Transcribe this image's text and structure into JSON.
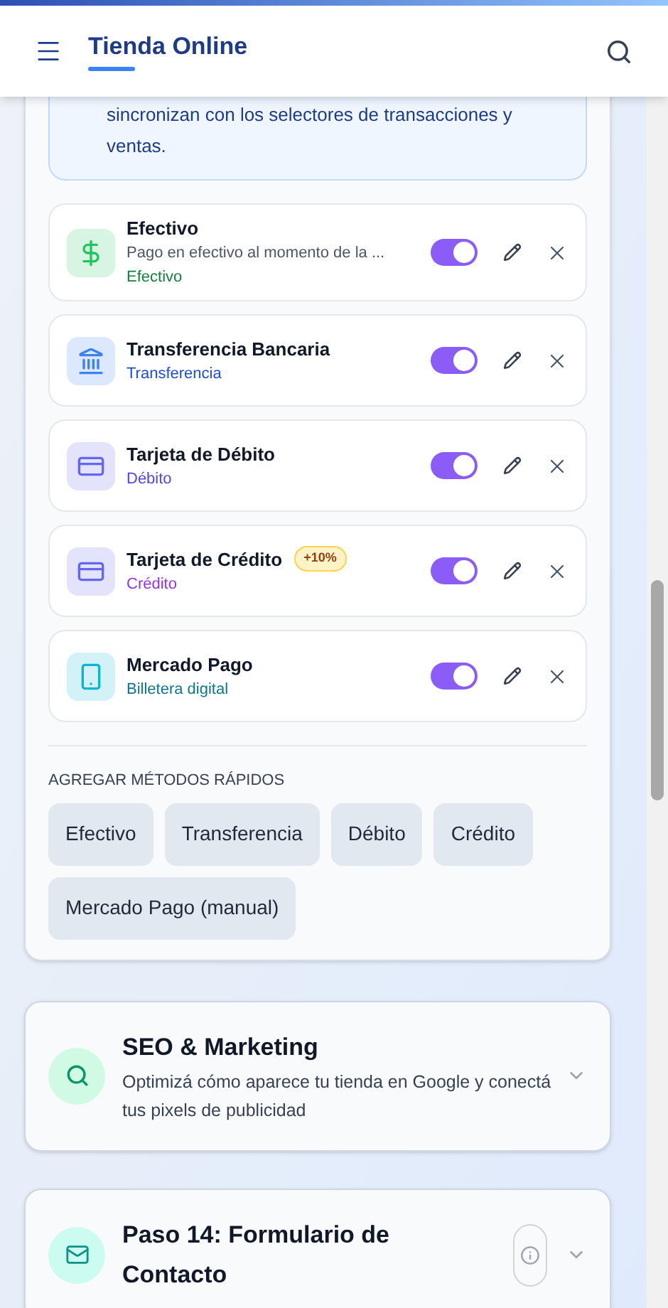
{
  "header": {
    "title": "Tienda Online"
  },
  "info_note": {
    "text": "sincronizan con los selectores de transacciones y ventas."
  },
  "methods": [
    {
      "kind": "cash",
      "name": "Efectivo",
      "description": "Pago en efectivo al momento de la ...",
      "type": "Efectivo",
      "color": "#15803d",
      "on": true
    },
    {
      "kind": "bank",
      "name": "Transferencia Bancaria",
      "type": "Transferencia",
      "color": "#1d4ed8",
      "on": true
    },
    {
      "kind": "card",
      "name": "Tarjeta de Débito",
      "type": "Débito",
      "color": "#4f46e5",
      "on": true
    },
    {
      "kind": "card",
      "name": "Tarjeta de Crédito",
      "badge": "+10%",
      "type": "Crédito",
      "color": "#9333ea",
      "on": true
    },
    {
      "kind": "phone",
      "name": "Mercado Pago",
      "type": "Billetera digital",
      "color": "#0e7490",
      "on": true
    }
  ],
  "quick_add": {
    "label": "AGREGAR MÉTODOS RÁPIDOS",
    "buttons": [
      "Efectivo",
      "Transferencia",
      "Débito",
      "Crédito",
      "Mercado Pago (manual)"
    ]
  },
  "sections": [
    {
      "kind": "search",
      "title": "SEO & Marketing",
      "description": "Optimizá cómo aparece tu tienda en Google y conectá tus pixels de publicidad",
      "expanded": false
    },
    {
      "kind": "mail",
      "title": "Paso 14: Formulario de Contacto",
      "info": true,
      "expanded": false
    }
  ]
}
